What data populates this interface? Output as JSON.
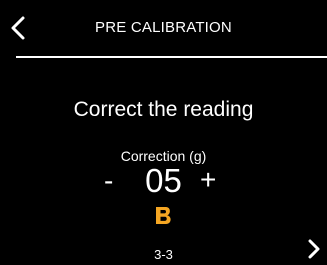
{
  "header": {
    "title": "PRE CALIBRATION",
    "back_icon": "chevron-left-icon"
  },
  "main": {
    "prompt": "Correct the reading",
    "correction_label": "Correction (g)",
    "minus": "-",
    "value": "05",
    "plus": "+",
    "brand_icon": "b-logo-icon",
    "brand_color": "#F5A623"
  },
  "footer": {
    "page_indicator": "3-3",
    "next_icon": "chevron-right-icon"
  }
}
